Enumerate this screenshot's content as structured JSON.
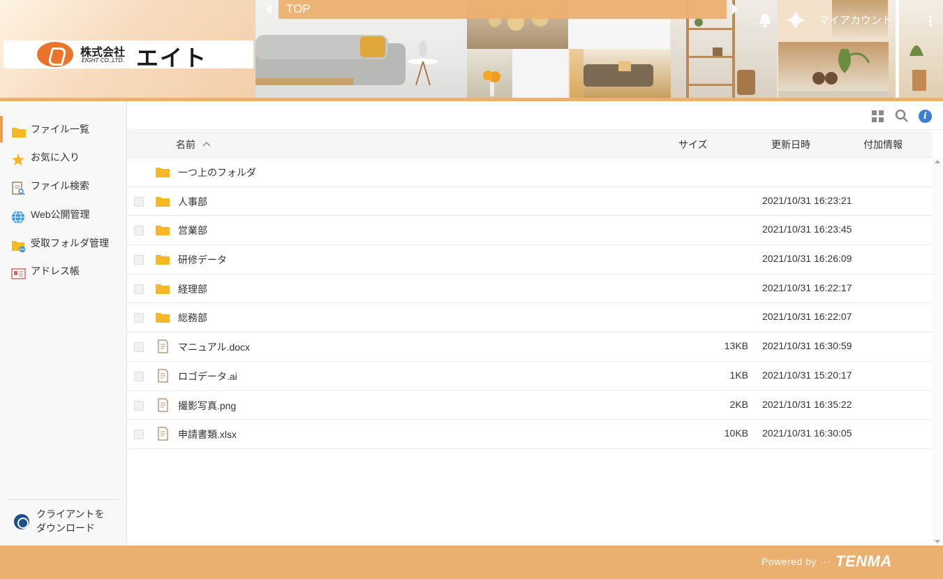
{
  "header": {
    "company_ja": "株式会社",
    "company_en": "EIGHT CO.,LTD.",
    "company_name": "エイト",
    "top_title": "TOP",
    "my_account": "マイアカウント"
  },
  "sidebar": {
    "items": [
      {
        "label": "ファイル一覧",
        "icon": "folder-icon"
      },
      {
        "label": "お気に入り",
        "icon": "star-icon"
      },
      {
        "label": "ファイル検索",
        "icon": "file-search-icon"
      },
      {
        "label": "Web公開管理",
        "icon": "globe-icon"
      },
      {
        "label": "受取フォルダ管理",
        "icon": "receive-folder-icon"
      },
      {
        "label": "アドレス帳",
        "icon": "address-book-icon"
      }
    ],
    "download_line1": "クライアントを",
    "download_line2": "ダウンロード"
  },
  "columns": {
    "name": "名前",
    "size": "サイズ",
    "date": "更新日時",
    "extra": "付加情報"
  },
  "files": [
    {
      "name": "一つ上のフォルダ",
      "type": "folder",
      "size": "",
      "date": "",
      "checkbox": false
    },
    {
      "name": "人事部",
      "type": "folder",
      "size": "",
      "date": "2021/10/31 16:23:21",
      "checkbox": true
    },
    {
      "name": "営業部",
      "type": "folder",
      "size": "",
      "date": "2021/10/31 16:23:45",
      "checkbox": true
    },
    {
      "name": "研修データ",
      "type": "folder",
      "size": "",
      "date": "2021/10/31 16:26:09",
      "checkbox": true
    },
    {
      "name": "経理部",
      "type": "folder",
      "size": "",
      "date": "2021/10/31 16:22:17",
      "checkbox": true
    },
    {
      "name": "総務部",
      "type": "folder",
      "size": "",
      "date": "2021/10/31 16:22:07",
      "checkbox": true
    },
    {
      "name": "マニュアル.docx",
      "type": "file",
      "size": "13KB",
      "date": "2021/10/31 16:30:59",
      "checkbox": true
    },
    {
      "name": "ロゴデータ.ai",
      "type": "file",
      "size": "1KB",
      "date": "2021/10/31 15:20:17",
      "checkbox": true
    },
    {
      "name": "撮影写真.png",
      "type": "file",
      "size": "2KB",
      "date": "2021/10/31 16:35:22",
      "checkbox": true
    },
    {
      "name": "申請書類.xlsx",
      "type": "file",
      "size": "10KB",
      "date": "2021/10/31 16:30:05",
      "checkbox": true
    }
  ],
  "footer": {
    "powered_by": "Powered by ···",
    "brand": "TENMA"
  },
  "colors": {
    "accent": "#ebb06f",
    "folder": "#f6b825",
    "active_marker": "#f0a04b",
    "info": "#3a7fd5"
  }
}
